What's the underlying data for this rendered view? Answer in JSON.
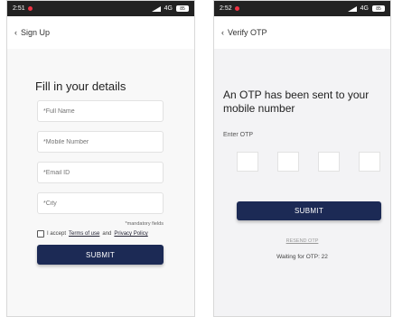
{
  "left_screen": {
    "status": {
      "time": "2:51",
      "network": "4G",
      "battery": "85"
    },
    "header": {
      "back_icon": "chevron-left-icon",
      "title": "Sign Up"
    },
    "title": "Fill in your details",
    "fields": [
      {
        "placeholder": "*Full Name"
      },
      {
        "placeholder": "*Mobile Number"
      },
      {
        "placeholder": "*Email ID"
      },
      {
        "placeholder": "*City"
      }
    ],
    "mandatory_note": "*mandatory fields",
    "terms": {
      "prefix": "I accept",
      "terms_link": "Terms of use",
      "and": "and",
      "privacy_link": "Privacy Policy"
    },
    "submit_label": "SUBMIT"
  },
  "right_screen": {
    "status": {
      "time": "2:52",
      "network": "4G",
      "battery": "85"
    },
    "header": {
      "back_icon": "chevron-left-icon",
      "title": "Verify OTP"
    },
    "title": "An OTP has been sent to your mobile number",
    "otp_label": "Enter OTP",
    "submit_label": "SUBMIT",
    "resend_label": "RESEND OTP",
    "waiting_text": "Waiting for OTP: 22"
  },
  "colors": {
    "primary_button": "#1c2a55",
    "status_bar": "#222222"
  }
}
